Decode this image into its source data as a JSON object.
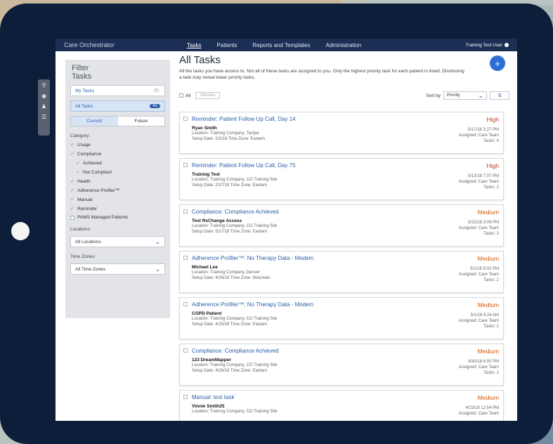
{
  "colors": {
    "frame": "#0d1e3a",
    "nav": "#1b2f55",
    "accent": "#2c6fd1",
    "high": "#c0392b",
    "medium": "#d35400"
  },
  "nav": {
    "brand": "Care Orchestrator",
    "links": [
      "Tasks",
      "Patients",
      "Reports and Templates",
      "Administration"
    ],
    "user": "Training Test User"
  },
  "tools": [
    "search-icon",
    "lightbulb-icon",
    "add-user-icon",
    "list-settings-icon"
  ],
  "filter": {
    "title_line1": "Filter",
    "title_line2": "Tasks",
    "my_tasks": {
      "label": "My Tasks",
      "count": "0"
    },
    "all_tasks": {
      "label": "All Tasks",
      "count": "41"
    },
    "current": "Current",
    "future": "Future",
    "category_label": "Category:",
    "categories": [
      {
        "label": "Usage",
        "sub": false
      },
      {
        "label": "Compliance",
        "sub": false
      },
      {
        "label": "Achieved",
        "sub": true
      },
      {
        "label": "Not Compliant",
        "sub": true
      },
      {
        "label": "Health",
        "sub": false
      },
      {
        "label": "Adherence Profiler™",
        "sub": false
      },
      {
        "label": "Manual",
        "sub": false
      },
      {
        "label": "Reminder",
        "sub": false
      }
    ],
    "pams": "PAMS Managed Patients",
    "locations_label": "Locations:",
    "locations_value": "All Locations",
    "timezones_label": "Time Zones:",
    "timezones_value": "All Time Zones"
  },
  "main": {
    "title": "All Tasks",
    "description": "All the tasks you have access to. Not all of these tasks are assigned to you. Only the highest priority task for each patient is listed. Dismissing a task may reveal lower priority tasks.",
    "add": "+",
    "all_label": "All",
    "dismiss": "Dismiss",
    "sort_label": "Sort by",
    "sort_value": "Priority"
  },
  "tasks": [
    {
      "title": "Reminder: Patient Follow Up Call, Day 14",
      "priority": "High",
      "name": "Ryan Smith",
      "location": "Location: Training Company, Tampa",
      "setup": "Setup Date: 5/3/18   Time Zone: Eastern",
      "date": "5/17/18 3:27 PM",
      "assigned": "Assigned: Care Team",
      "tasks": "Tasks: 4"
    },
    {
      "title": "Reminder: Patient Follow Up Call, Day 75",
      "priority": "High",
      "name": "Training Test",
      "location": "Location: Training Company, CO Training Site",
      "setup": "Setup Date: 2/27/18   Time Zone: Eastern",
      "date": "5/13/18 7:07 PM",
      "assigned": "Assigned: Care Team",
      "tasks": "Tasks: 2"
    },
    {
      "title": "Compliance: Compliance Achieved",
      "priority": "Medium",
      "name": "Test RxChange Access",
      "location": "Location: Training Company, CO Training Site",
      "setup": "Setup Date: 5/17/18   Time Zone: Eastern",
      "date": "5/22/18 3:09 PM",
      "assigned": "Assigned: Care Team",
      "tasks": "Tasks: 3"
    },
    {
      "title": "Adherence Profiler™: No Therapy Data - Modem",
      "priority": "Medium",
      "name": "Michael Lee",
      "location": "Location: Training Company, Denver",
      "setup": "Setup Date: 4/26/18   Time Zone: Mountain",
      "date": "5/1/18 8:01 PM",
      "assigned": "Assigned: Care Team",
      "tasks": "Tasks: 2"
    },
    {
      "title": "Adherence Profiler™: No Therapy Data - Modem",
      "priority": "Medium",
      "name": "COPD Patient",
      "location": "Location: Training Company, CO Training Site",
      "setup": "Setup Date: 4/25/18   Time Zone: Eastern",
      "date": "5/1/18 9:24 AM",
      "assigned": "Assigned: Care Team",
      "tasks": "Tasks: 1"
    },
    {
      "title": "Compliance: Compliance Achieved",
      "priority": "Medium",
      "name": "123 DreamMapper",
      "location": "Location: Training Company, CO Training Site",
      "setup": "Setup Date: 4/26/18   Time Zone: Eastern",
      "date": "4/30/18 6:00 PM",
      "assigned": "Assigned: Care Team",
      "tasks": "Tasks: 2"
    },
    {
      "title": "Manual: test task",
      "priority": "Medium",
      "name": "Vinnie Smith25",
      "location": "Location: Training Company, CO Training Site",
      "setup": "",
      "date": "4/23/18 12:54 PM",
      "assigned": "Assigned: Care Team",
      "tasks": ""
    }
  ]
}
